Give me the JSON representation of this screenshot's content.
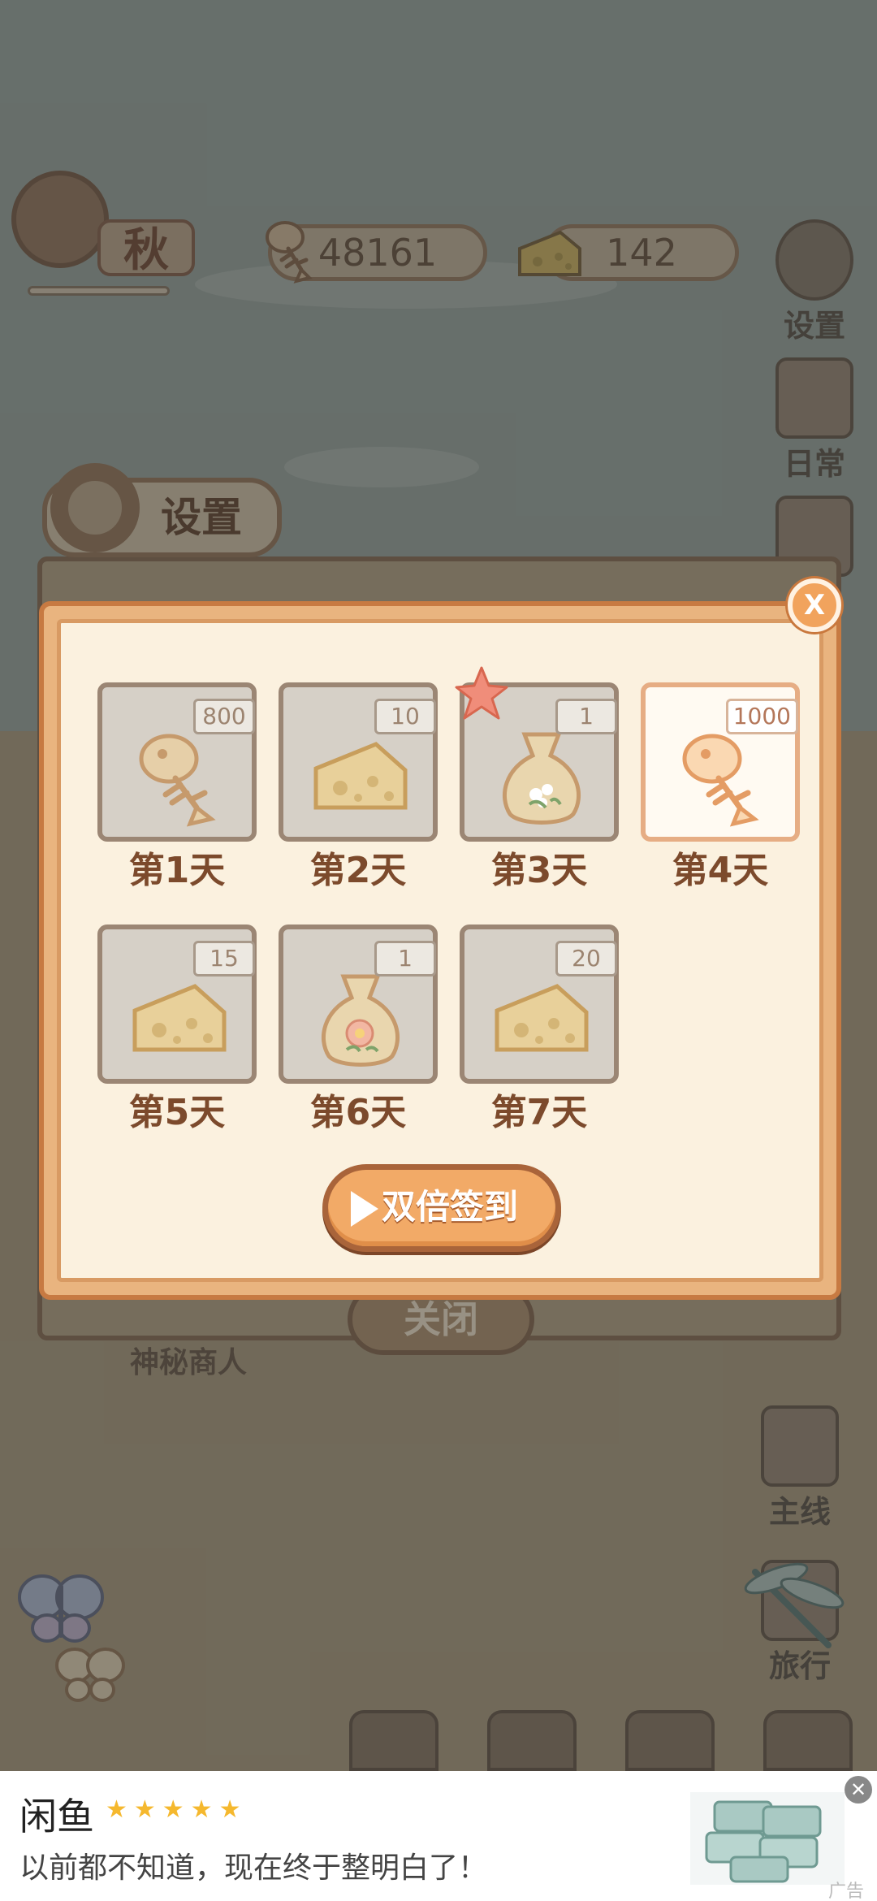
{
  "top_bar": {
    "season": "秋",
    "fish_bones": "48161",
    "cheese": "142"
  },
  "side_menu": {
    "settings_label": "设置",
    "daily_label": "日常",
    "quest_label": "主线",
    "travel_label": "旅行"
  },
  "settings_dialog": {
    "title": "设置",
    "close_label": "关闭",
    "merchant_label": "神秘商人"
  },
  "signin": {
    "close_label": "X",
    "days": [
      {
        "label": "第1天",
        "count": "800",
        "icon": "fish-bone-icon",
        "active": false
      },
      {
        "label": "第2天",
        "count": "10",
        "icon": "cheese-icon",
        "active": false
      },
      {
        "label": "第3天",
        "count": "1",
        "icon": "seed-bag-icon",
        "active": false
      },
      {
        "label": "第4天",
        "count": "1000",
        "icon": "fish-bone-icon",
        "active": true
      },
      {
        "label": "第5天",
        "count": "15",
        "icon": "cheese-icon",
        "active": false
      },
      {
        "label": "第6天",
        "count": "1",
        "icon": "flower-seed-bag-icon",
        "active": false
      },
      {
        "label": "第7天",
        "count": "20",
        "icon": "cheese-icon",
        "active": false
      }
    ],
    "double_button": "双倍签到"
  },
  "ad": {
    "title": "闲鱼",
    "stars": "★★★★★",
    "description": "以前都不知道，现在终于整明白了！",
    "label": "广告",
    "close": "✕"
  },
  "colors": {
    "accent": "#f2aa67",
    "modal_border": "#c77a42",
    "modal_bg": "#fbf1df",
    "day_label": "#7c4a2c"
  }
}
